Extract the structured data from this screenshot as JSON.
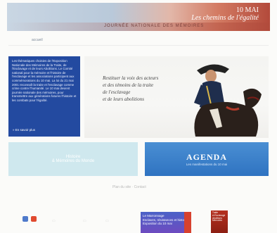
{
  "banner": {
    "title_line1": "10 MAI",
    "title_line2": "Les chemins de l'égalité",
    "subtitle": "JOURNÉE NATIONALE DES MÉMOIRES"
  },
  "nav": {
    "home_link": "accueil"
  },
  "intro": {
    "text": "Les thématiques choisies de l'Exposition Nationale des Mémoires de la Traite, de l'Esclavage et de leurs Abolitions. Le Comité national pour la mémoire et l'histoire de l'esclavage et les associations participent aux commémorations du 10 mai. La loi du 21 mai 2001 reconnaît la traite et l'esclavage comme crime contre l'humanité. Le 10 mai devient journée nationale des mémoires, pour transmettre aux générations futures l'histoire et les combats pour l'égalité.",
    "more_link": "» En savoir plus"
  },
  "feature": {
    "line1": "Restituer la voix des acteurs",
    "line2": "et des témoins de la traite",
    "line3": "de l'esclavage",
    "line4": "et de leurs abolitions"
  },
  "promo_left": {
    "line1": "Histoire",
    "line2": "& Mémoires du Monde"
  },
  "promo_right": {
    "title": "AGENDA",
    "subtitle": "Les manifestations du 10 mai"
  },
  "footer": {
    "link": "Plan du site · Contact"
  },
  "book": {
    "line1": "Le Marronnage",
    "line2": "Esclaves, résistances et histoire",
    "line3": "Exposition du 10 mai"
  },
  "poster": {
    "line1": "Traite",
    "line2": "et Esclavage",
    "line3": "Abolitions",
    "line4": "Mémoires"
  }
}
